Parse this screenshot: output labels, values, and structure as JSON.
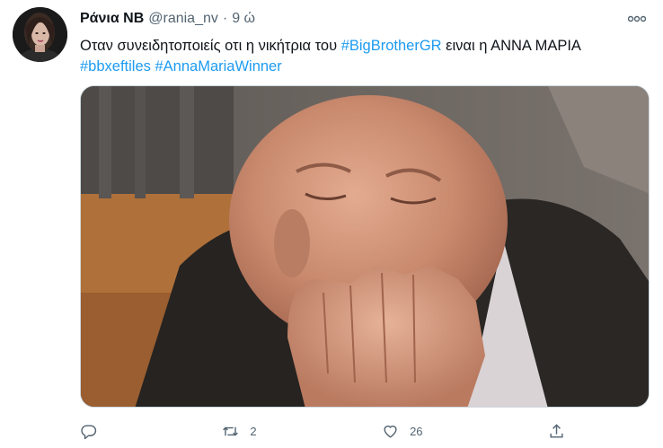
{
  "tweet": {
    "author_name": "Ράνια ΝΒ",
    "handle": "@rania_nv",
    "separator": "·",
    "time": "9 ώ",
    "text_before": "Οταν συνειδητοποιείς οτι η νικήτρια του ",
    "hashtag_1": "#BigBrotherGR",
    "text_after": " ειναι η ΑΝΝΑ ΜΑΡΙΑ  ",
    "hashtag_2": "#bbxeftiles",
    "hashtag_3": "#AnnaMariaWinner"
  },
  "actions": {
    "reply_icon": "reply-icon",
    "retweet_icon": "retweet-icon",
    "retweet_count": "2",
    "like_icon": "heart-icon",
    "like_count": "26",
    "share_icon": "share-icon"
  },
  "colors": {
    "link": "#1d9bf0",
    "secondary_text": "#536471",
    "primary_text": "#0f1419"
  }
}
